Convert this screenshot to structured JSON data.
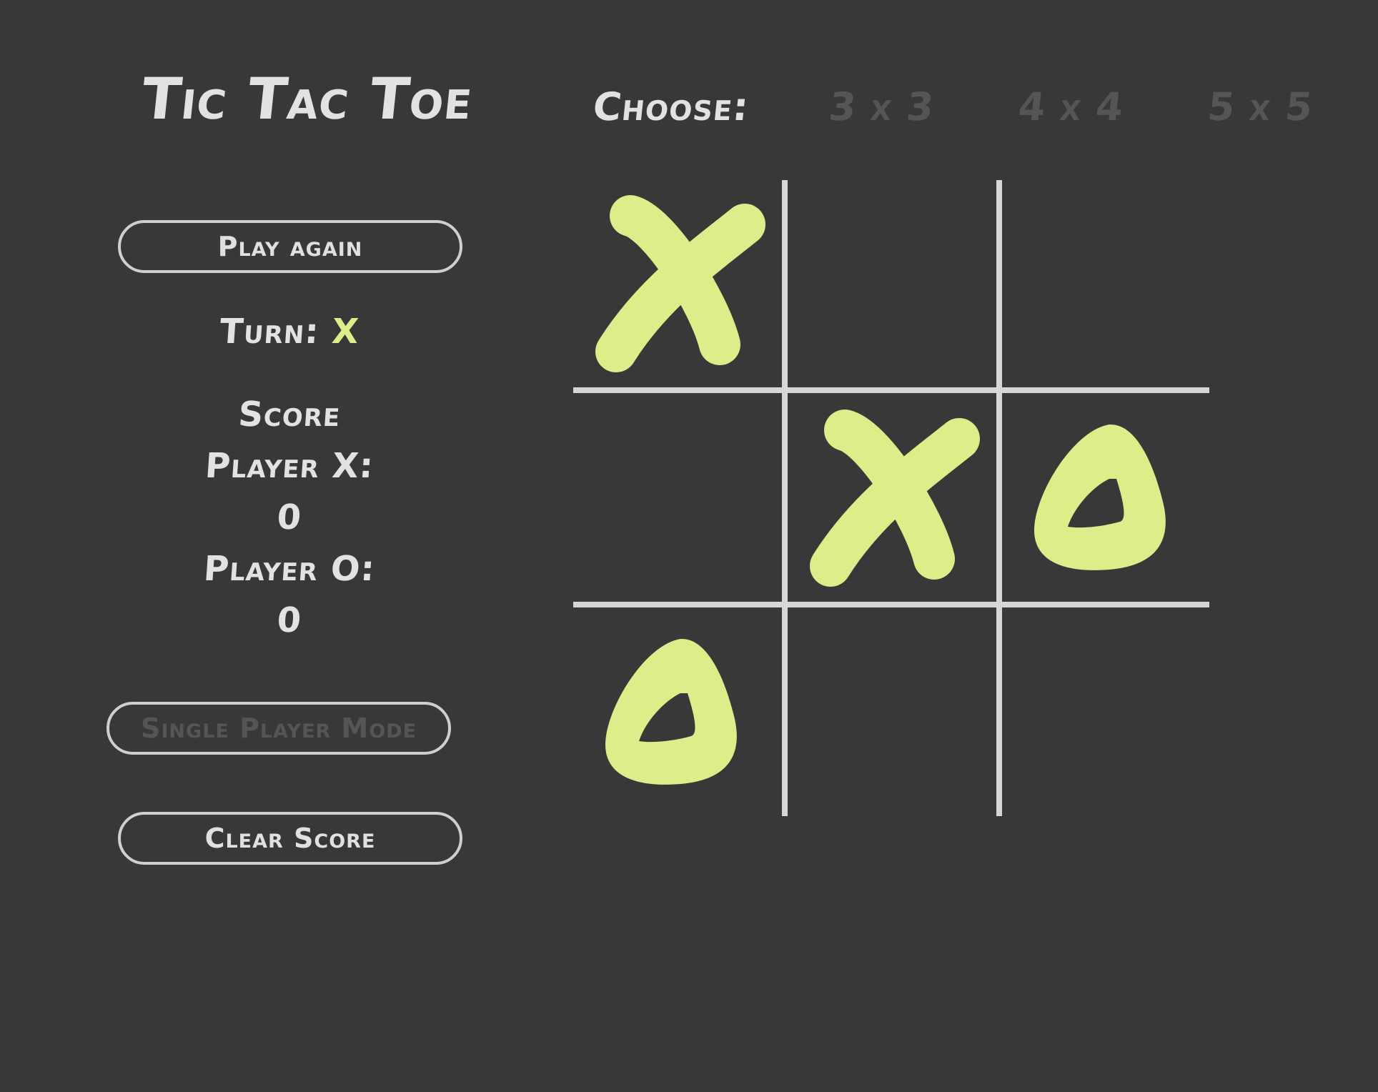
{
  "header": {
    "title": "Tic Tac Toe",
    "choose_label": "Choose:",
    "size_options": [
      "3 x 3",
      "4 x 4",
      "5 x 5"
    ]
  },
  "sidebar": {
    "play_again_label": "Play again",
    "turn_label": "Turn:",
    "turn_value": "X",
    "score_heading": "Score",
    "player_x_label": "Player X:",
    "player_x_score": "0",
    "player_o_label": "Player O:",
    "player_o_score": "0",
    "single_player_label": "Single Player Mode",
    "clear_score_label": "Clear Score"
  },
  "board": {
    "size": 3,
    "cells": [
      "X",
      "",
      "",
      "",
      "X",
      "O",
      "O",
      "",
      ""
    ],
    "mark_color": "#dfec8a",
    "line_color": "#d6d6d6",
    "background": "#383838"
  }
}
